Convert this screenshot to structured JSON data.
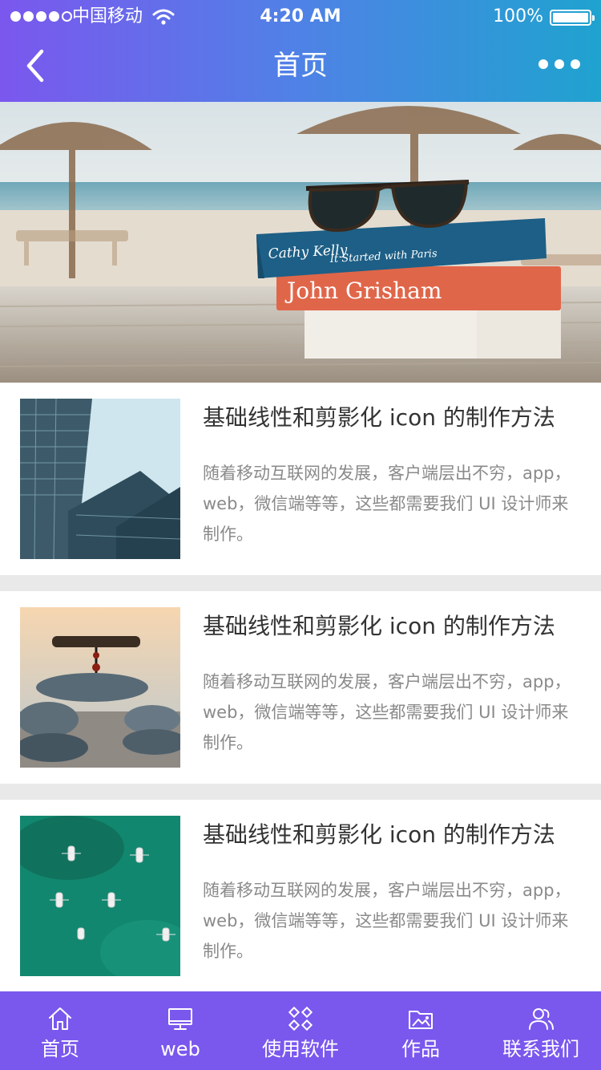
{
  "status_bar": {
    "carrier": "中国移动",
    "time": "4:20 AM",
    "battery": "100%"
  },
  "nav": {
    "title": "首页",
    "back_icon": "chevron-left-icon",
    "more_icon": "more-horizontal-icon"
  },
  "banner": {
    "book_top": "Cathy Kelly",
    "book_top_subtitle": "It Started with Paris",
    "book_middle": "John Grisham"
  },
  "articles": [
    {
      "title": "基础线性和剪影化 icon 的制作方法",
      "description": "随着移动互联网的发展，客户端层出不穷，app，web，微信端等等，这些都需要我们 UI 设计师来制作。"
    },
    {
      "title": "基础线性和剪影化 icon 的制作方法",
      "description": "随着移动互联网的发展，客户端层出不穷，app，web，微信端等等，这些都需要我们 UI 设计师来制作。"
    },
    {
      "title": "基础线性和剪影化 icon 的制作方法",
      "description": "随着移动互联网的发展，客户端层出不穷，app，web，微信端等等，这些都需要我们 UI 设计师来制作。"
    }
  ],
  "tabbar": {
    "items": [
      {
        "label": "首页",
        "icon": "home-icon"
      },
      {
        "label": "web",
        "icon": "monitor-icon"
      },
      {
        "label": "使用软件",
        "icon": "apps-icon"
      },
      {
        "label": "作品",
        "icon": "folder-image-icon"
      },
      {
        "label": "联系我们",
        "icon": "users-icon"
      }
    ]
  },
  "colors": {
    "header_gradient_start": "#7b57ee",
    "header_gradient_end": "#1fa3cf",
    "tabbar_bg": "#7a58ee",
    "title_text": "#333333",
    "desc_text": "#8a8a8a"
  }
}
